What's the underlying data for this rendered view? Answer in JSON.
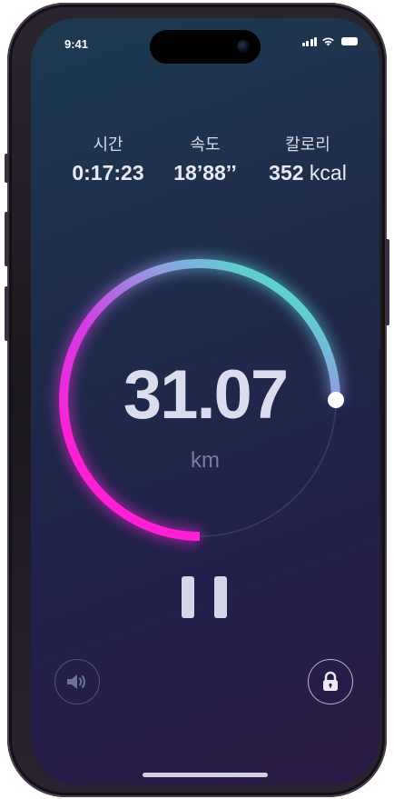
{
  "status_bar": {
    "time": "9:41",
    "icons": [
      "cellular-signal-icon",
      "wifi-icon",
      "battery-icon"
    ]
  },
  "stats": [
    {
      "label": "시간",
      "value": "0:17:23",
      "unit": ""
    },
    {
      "label": "속도",
      "value": "18’88’’",
      "unit": ""
    },
    {
      "label": "칼로리",
      "value": "352",
      "unit": "kcal"
    }
  ],
  "progress": {
    "distance": "31.07",
    "unit": "km",
    "fraction": 0.75,
    "gradient_colors": [
      "#ff1fd6",
      "#9b8be0",
      "#3ff0c8"
    ]
  },
  "controls": {
    "pause": "pause-icon",
    "sound": "speaker-icon",
    "lock": "lock-icon"
  },
  "colors": {
    "background_top": "#1d3a52",
    "background_bottom": "#2b1a45",
    "text": "#dcdcef",
    "muted": "#7e7c9e"
  }
}
